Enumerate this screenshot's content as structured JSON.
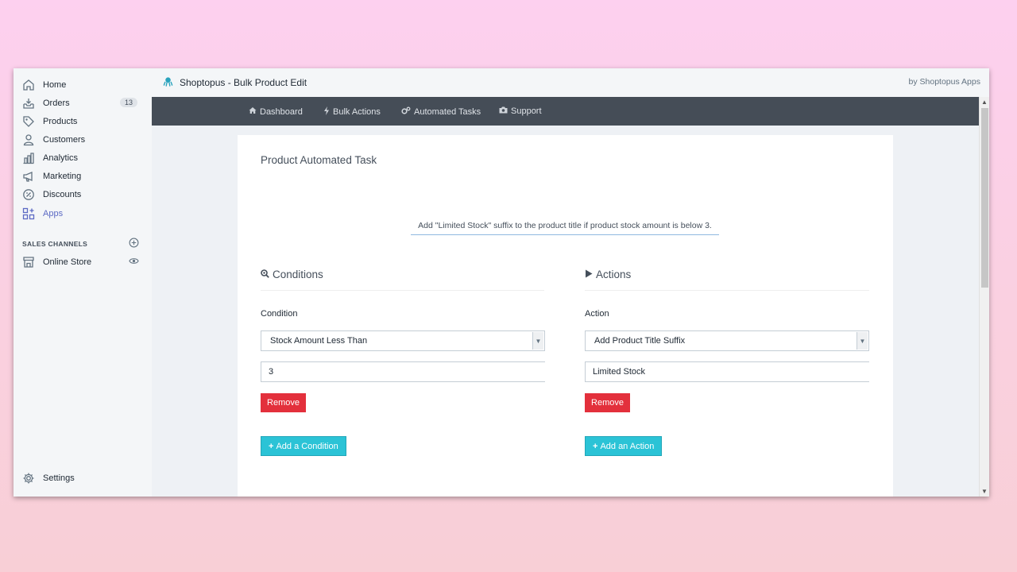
{
  "sidebar": {
    "items": [
      {
        "label": "Home",
        "icon": "home-icon"
      },
      {
        "label": "Orders",
        "icon": "orders-icon",
        "badge": "13"
      },
      {
        "label": "Products",
        "icon": "tag-icon"
      },
      {
        "label": "Customers",
        "icon": "person-icon"
      },
      {
        "label": "Analytics",
        "icon": "bar-chart-icon"
      },
      {
        "label": "Marketing",
        "icon": "megaphone-icon"
      },
      {
        "label": "Discounts",
        "icon": "discount-icon"
      },
      {
        "label": "Apps",
        "icon": "apps-icon",
        "active": true
      }
    ],
    "sales_channels_title": "SALES CHANNELS",
    "online_store": "Online Store",
    "settings": "Settings"
  },
  "header": {
    "app_title": "Shoptopus - Bulk Product Edit",
    "by": "by Shoptopus Apps"
  },
  "menu": {
    "dashboard": "Dashboard",
    "bulk_actions": "Bulk Actions",
    "automated_tasks": "Automated Tasks",
    "support": "Support"
  },
  "task": {
    "title": "Product Automated Task",
    "description": "Add \"Limited Stock\" suffix to the product title if product stock amount is below 3.",
    "conditions": {
      "heading": "Conditions",
      "label": "Condition",
      "selected": "Stock Amount Less Than",
      "value": "3",
      "remove": "Remove",
      "add": "Add a Condition"
    },
    "actions": {
      "heading": "Actions",
      "label": "Action",
      "selected": "Add Product Title Suffix",
      "value": "Limited Stock",
      "remove": "Remove",
      "add": "Add an Action"
    }
  },
  "colors": {
    "accent": "#5c6ac4",
    "danger": "#e3303c",
    "info": "#2bc3d6",
    "menubar": "#454d57"
  }
}
